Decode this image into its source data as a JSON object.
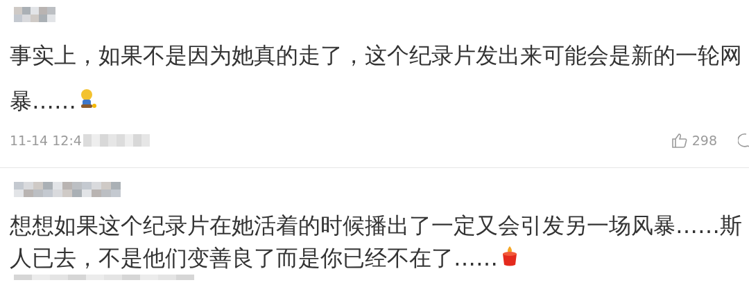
{
  "comments": [
    {
      "lines": [
        "事实上，如果不是因为她真的走了，这个纪录片发出来可能会是新的一轮网",
        "暴……"
      ],
      "emoji": {
        "kind": "figure"
      },
      "time": "11-14 12:4",
      "likes": "298"
    },
    {
      "lines": [
        "想想如果这个纪录片在她活着的时候播出了一定又会引发另一场风暴……斯",
        "人已去，不是他们变善良了而是你已经不在了……"
      ],
      "emoji": {
        "kind": "candle"
      }
    }
  ]
}
